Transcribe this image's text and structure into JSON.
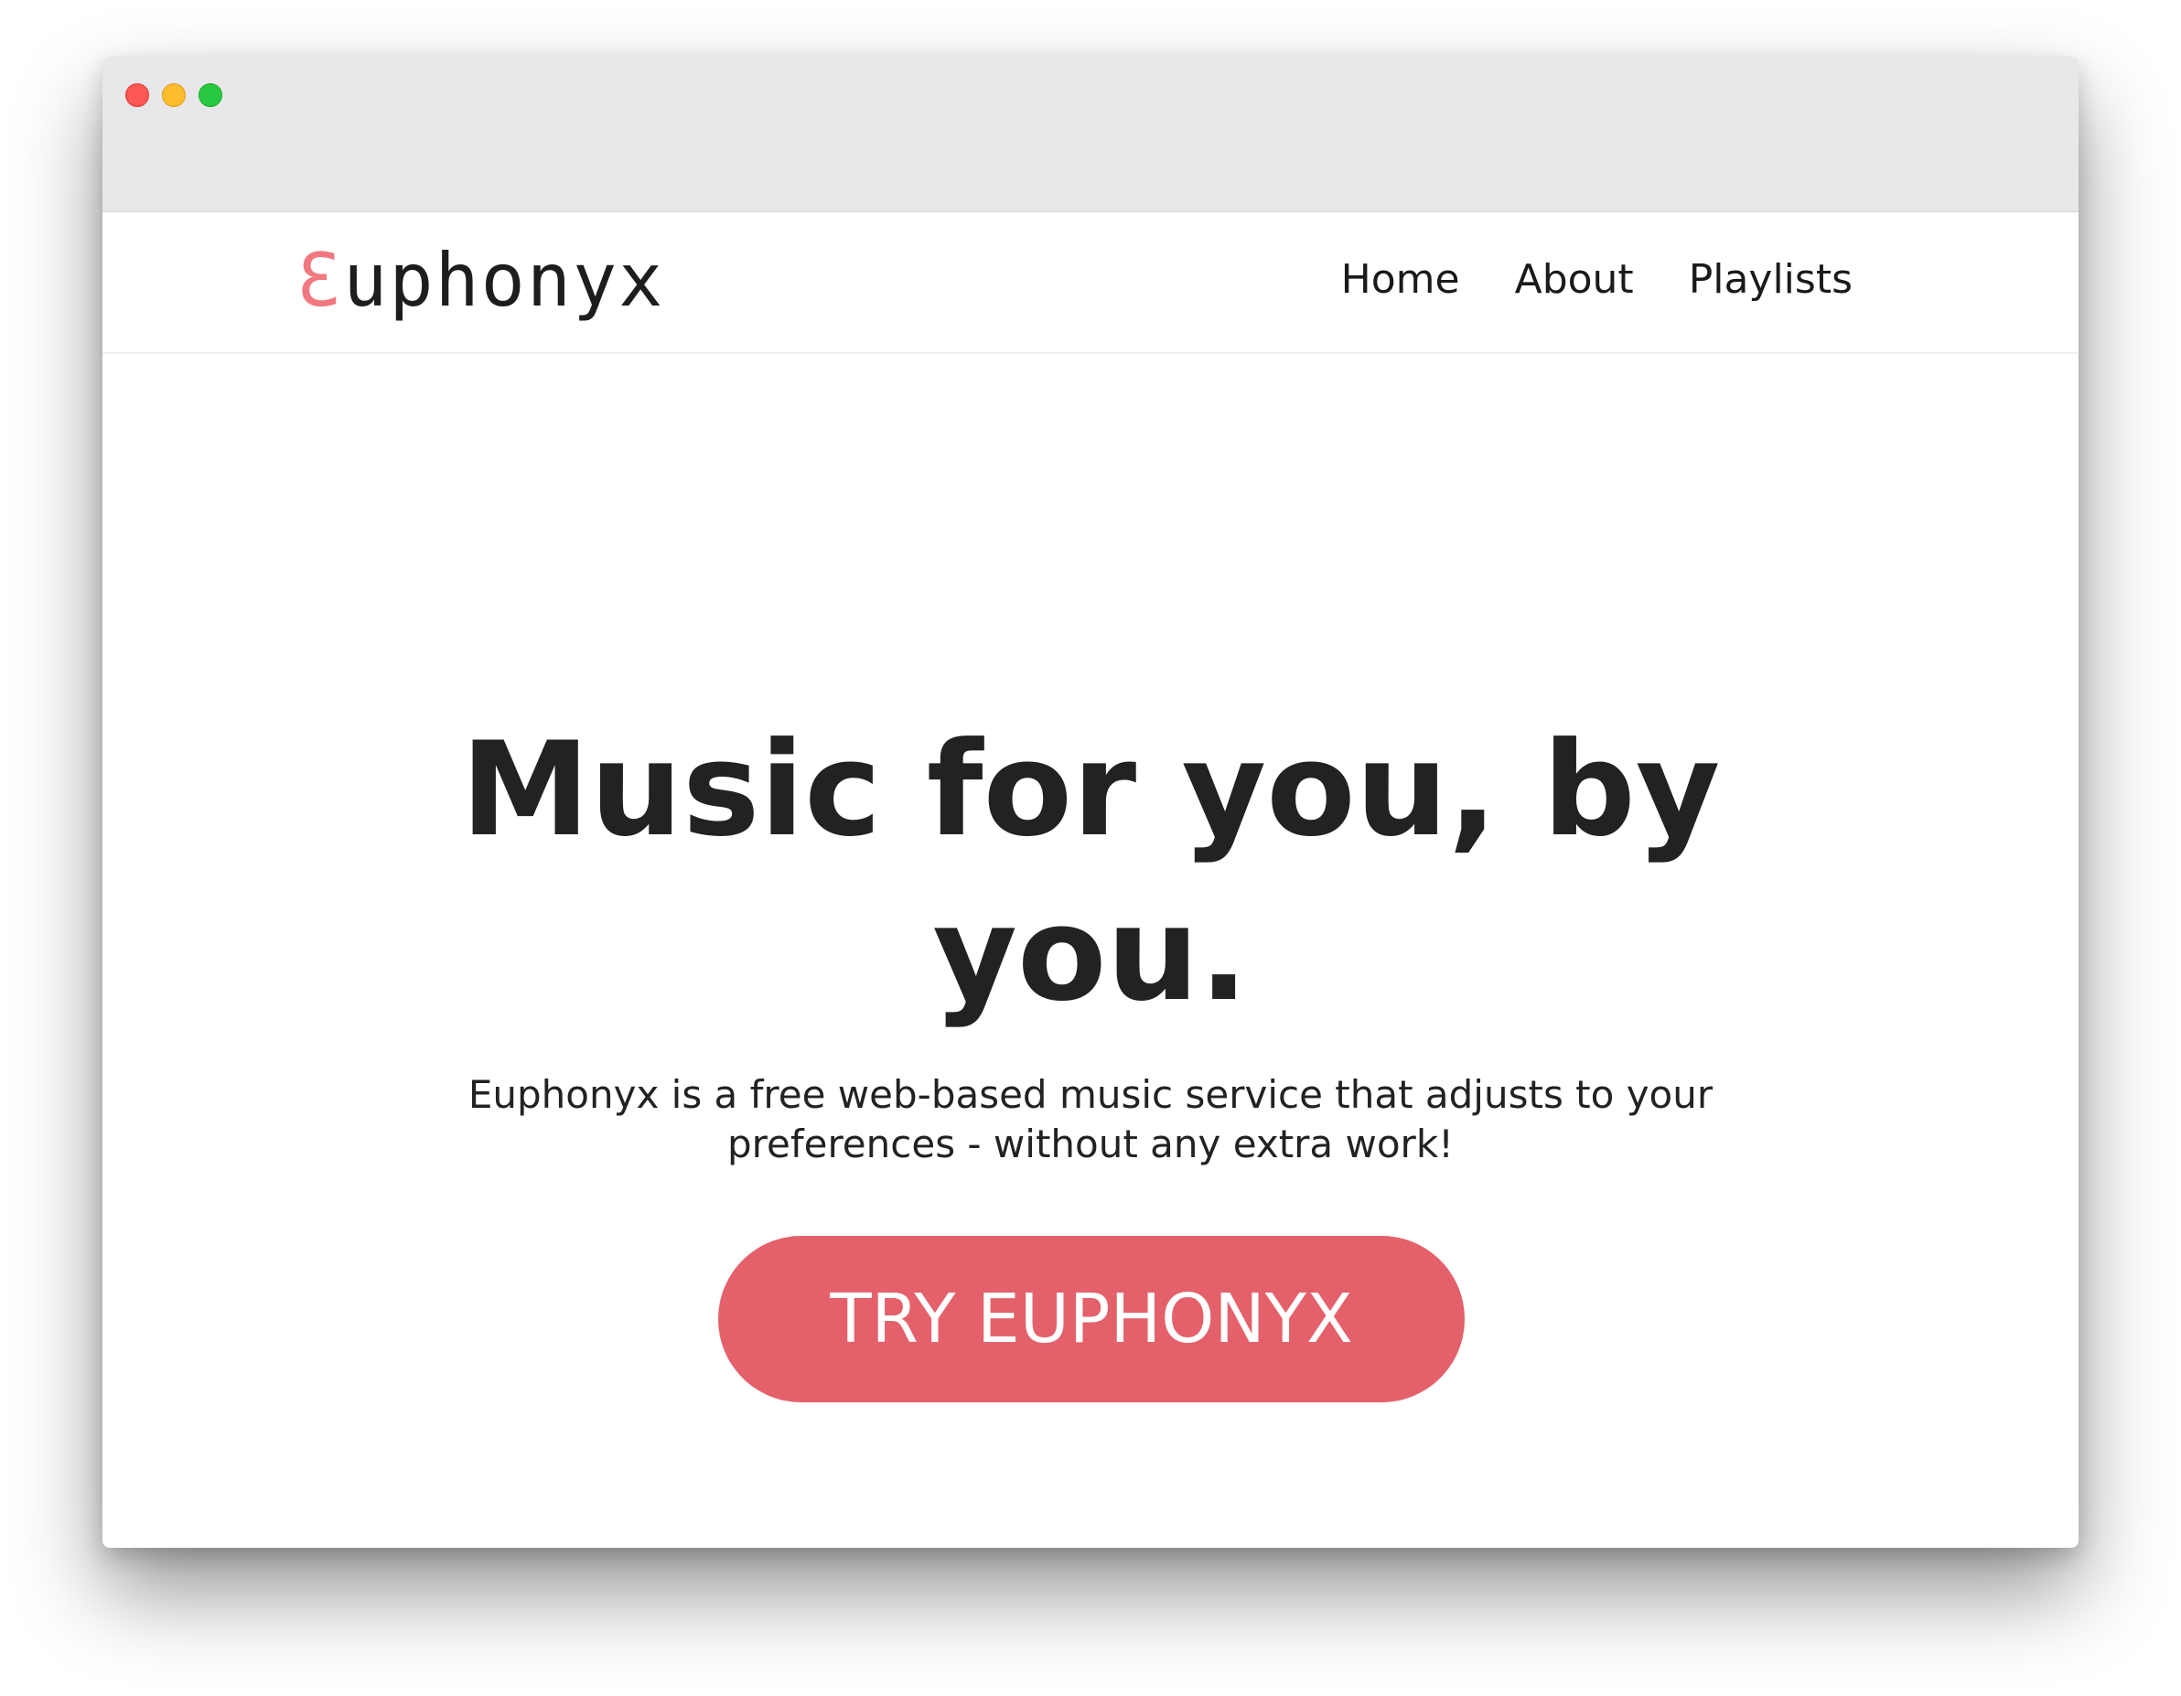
{
  "browser": {
    "controls": [
      "close",
      "minimize",
      "zoom"
    ]
  },
  "navbar": {
    "logo": {
      "mark": "Ɛ",
      "text": "uphonyx"
    },
    "links": [
      {
        "label": "Home"
      },
      {
        "label": "About"
      },
      {
        "label": "Playlists"
      }
    ]
  },
  "hero": {
    "headline": "Music for you, by you.",
    "subtitle": "Euphonyx is a free web-based music service that adjusts to your preferences - without any extra work!",
    "cta_label": "TRY EUPHONYX"
  },
  "colors": {
    "accent": "#e4606a",
    "logo_mark": "#f0787f",
    "text": "#222222",
    "titlebar": "#e8e7e9"
  }
}
